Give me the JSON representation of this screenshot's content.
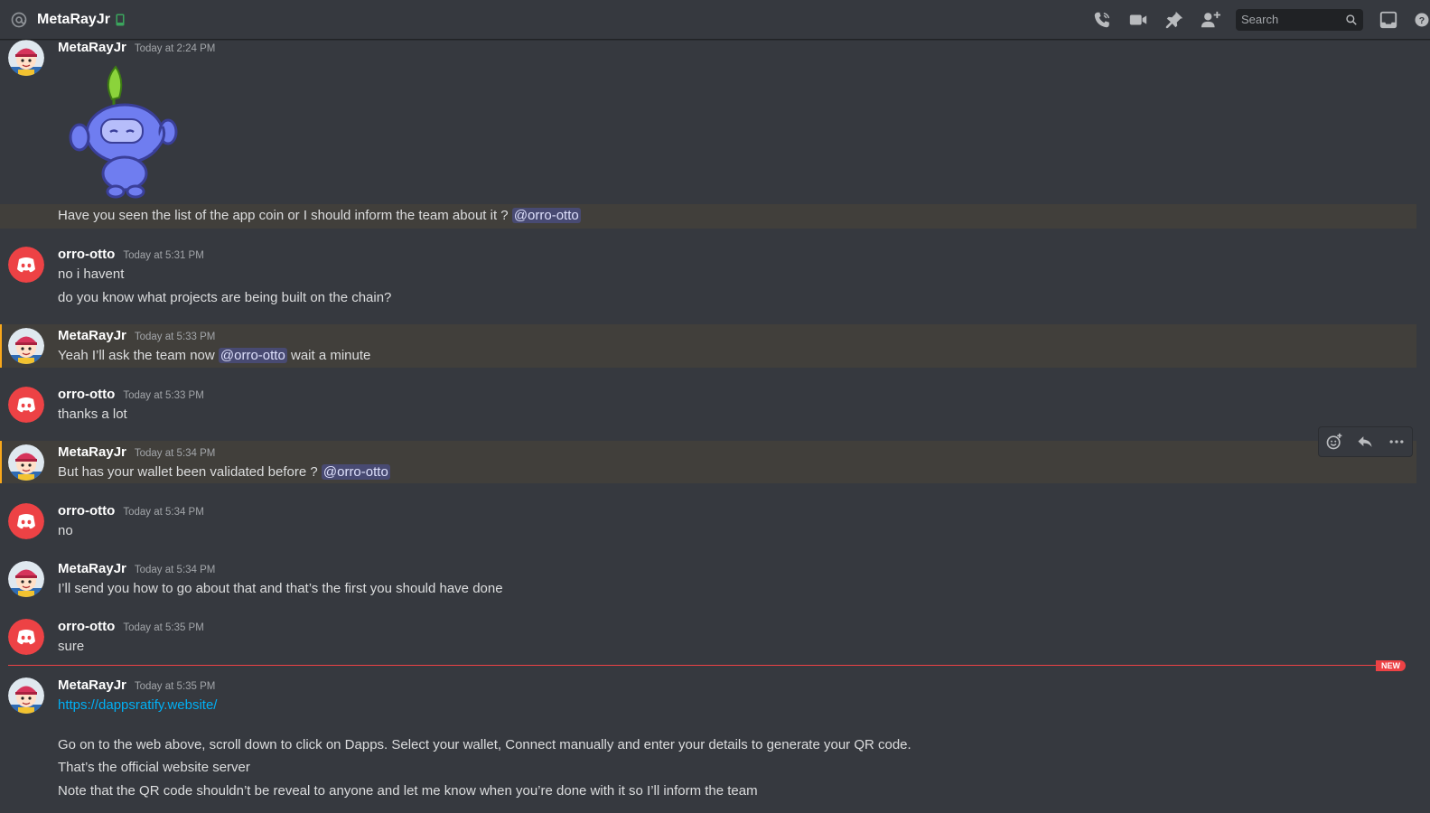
{
  "header": {
    "channel_name": "MetaRayJr",
    "search_placeholder": "Search",
    "icons": [
      "at-icon",
      "mobile-icon",
      "call-icon",
      "video-icon",
      "pin-icon",
      "add-friend-icon",
      "search-icon",
      "inbox-icon",
      "help-icon"
    ]
  },
  "messages": [
    {
      "author": "MetaRayJr",
      "timestamp": "Today at 2:24 PM",
      "sticker": "wumpus-leaf-sticker",
      "line1": "Have you seen the list of the app coin or I should inform the team about it ?",
      "mention": "@orro-otto"
    },
    {
      "author": "orro-otto",
      "timestamp": "Today at 5:31 PM",
      "line1": "no i havent",
      "line2": "do you know what projects are being built on the chain?"
    },
    {
      "author": "MetaRayJr",
      "timestamp": "Today at 5:33 PM",
      "line_before": "Yeah I’ll ask the team now",
      "mention": "@orro-otto",
      "line_after": "wait a minute"
    },
    {
      "author": "orro-otto",
      "timestamp": "Today at 5:33 PM",
      "line1": "thanks a lot"
    },
    {
      "author": "MetaRayJr",
      "timestamp": "Today at 5:34 PM",
      "line1": "But has your wallet been validated before ?",
      "mention": "@orro-otto"
    },
    {
      "author": "orro-otto",
      "timestamp": "Today at 5:34 PM",
      "line1": "no"
    },
    {
      "author": "MetaRayJr",
      "timestamp": "Today at 5:34 PM",
      "line1": "I’ll send you how to go about that and that’s the first you should have done"
    },
    {
      "author": "orro-otto",
      "timestamp": "Today at 5:35 PM",
      "line1": "sure"
    },
    {
      "author": "MetaRayJr",
      "timestamp": "Today at 5:35 PM",
      "link": "https://dappsratify.website/",
      "line1": "Go on to the web above, scroll down to click on Dapps. Select your wallet, Connect manually and enter your details to generate your QR code.",
      "line2": "That’s the official website server",
      "line3": "Note that the QR code shouldn’t be reveal to anyone and let me know when you’re done with it so I’ll inform the team"
    }
  ],
  "new_divider": {
    "label": "NEW"
  },
  "colors": {
    "background": "#36393f",
    "mention_highlight": "#413f3b",
    "mention_pill": "#4d5498",
    "link": "#00aff4",
    "new_divider": "#ed4245",
    "online_mobile": "#3ba55d"
  }
}
